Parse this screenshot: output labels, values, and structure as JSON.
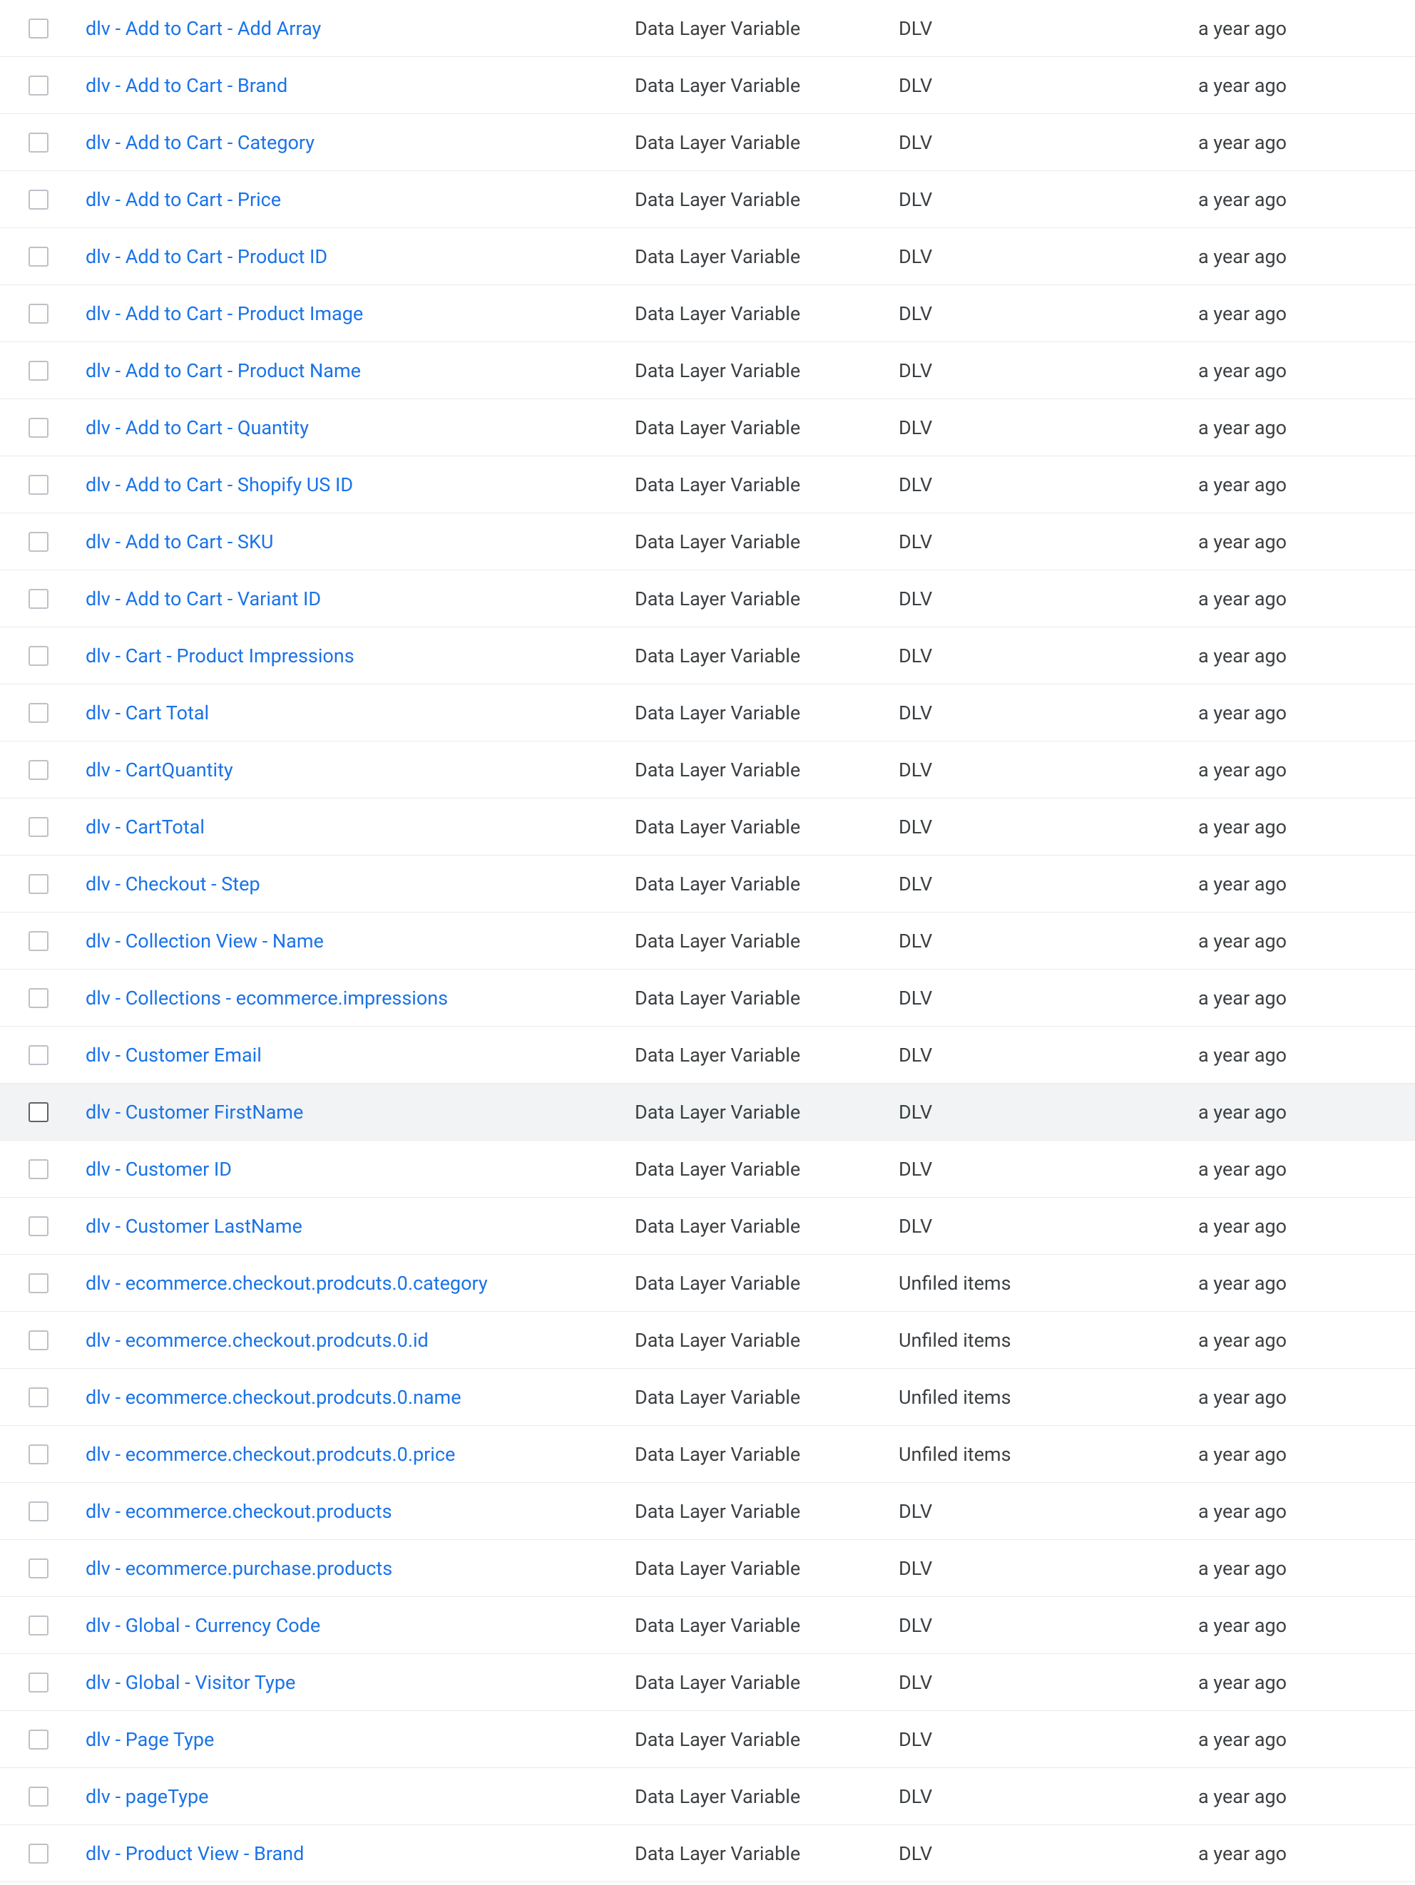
{
  "rows": [
    {
      "name": "dlv - Add to Cart - Add Array",
      "type": "Data Layer Variable",
      "folder": "DLV",
      "modified": "a year ago",
      "hovered": false
    },
    {
      "name": "dlv - Add to Cart - Brand",
      "type": "Data Layer Variable",
      "folder": "DLV",
      "modified": "a year ago",
      "hovered": false
    },
    {
      "name": "dlv - Add to Cart - Category",
      "type": "Data Layer Variable",
      "folder": "DLV",
      "modified": "a year ago",
      "hovered": false
    },
    {
      "name": "dlv - Add to Cart - Price",
      "type": "Data Layer Variable",
      "folder": "DLV",
      "modified": "a year ago",
      "hovered": false
    },
    {
      "name": "dlv - Add to Cart - Product ID",
      "type": "Data Layer Variable",
      "folder": "DLV",
      "modified": "a year ago",
      "hovered": false
    },
    {
      "name": "dlv - Add to Cart - Product Image",
      "type": "Data Layer Variable",
      "folder": "DLV",
      "modified": "a year ago",
      "hovered": false
    },
    {
      "name": "dlv - Add to Cart - Product Name",
      "type": "Data Layer Variable",
      "folder": "DLV",
      "modified": "a year ago",
      "hovered": false
    },
    {
      "name": "dlv - Add to Cart - Quantity",
      "type": "Data Layer Variable",
      "folder": "DLV",
      "modified": "a year ago",
      "hovered": false
    },
    {
      "name": "dlv - Add to Cart - Shopify US ID",
      "type": "Data Layer Variable",
      "folder": "DLV",
      "modified": "a year ago",
      "hovered": false
    },
    {
      "name": "dlv - Add to Cart - SKU",
      "type": "Data Layer Variable",
      "folder": "DLV",
      "modified": "a year ago",
      "hovered": false
    },
    {
      "name": "dlv - Add to Cart - Variant ID",
      "type": "Data Layer Variable",
      "folder": "DLV",
      "modified": "a year ago",
      "hovered": false
    },
    {
      "name": "dlv - Cart - Product Impressions",
      "type": "Data Layer Variable",
      "folder": "DLV",
      "modified": "a year ago",
      "hovered": false
    },
    {
      "name": "dlv - Cart Total",
      "type": "Data Layer Variable",
      "folder": "DLV",
      "modified": "a year ago",
      "hovered": false
    },
    {
      "name": "dlv - CartQuantity",
      "type": "Data Layer Variable",
      "folder": "DLV",
      "modified": "a year ago",
      "hovered": false
    },
    {
      "name": "dlv - CartTotal",
      "type": "Data Layer Variable",
      "folder": "DLV",
      "modified": "a year ago",
      "hovered": false
    },
    {
      "name": "dlv - Checkout - Step",
      "type": "Data Layer Variable",
      "folder": "DLV",
      "modified": "a year ago",
      "hovered": false
    },
    {
      "name": "dlv - Collection View - Name",
      "type": "Data Layer Variable",
      "folder": "DLV",
      "modified": "a year ago",
      "hovered": false
    },
    {
      "name": "dlv - Collections - ecommerce.impressions",
      "type": "Data Layer Variable",
      "folder": "DLV",
      "modified": "a year ago",
      "hovered": false
    },
    {
      "name": "dlv - Customer Email",
      "type": "Data Layer Variable",
      "folder": "DLV",
      "modified": "a year ago",
      "hovered": false
    },
    {
      "name": "dlv - Customer FirstName",
      "type": "Data Layer Variable",
      "folder": "DLV",
      "modified": "a year ago",
      "hovered": true
    },
    {
      "name": "dlv - Customer ID",
      "type": "Data Layer Variable",
      "folder": "DLV",
      "modified": "a year ago",
      "hovered": false
    },
    {
      "name": "dlv - Customer LastName",
      "type": "Data Layer Variable",
      "folder": "DLV",
      "modified": "a year ago",
      "hovered": false
    },
    {
      "name": "dlv - ecommerce.checkout.prodcuts.0.category",
      "type": "Data Layer Variable",
      "folder": "Unfiled items",
      "modified": "a year ago",
      "hovered": false
    },
    {
      "name": "dlv - ecommerce.checkout.prodcuts.0.id",
      "type": "Data Layer Variable",
      "folder": "Unfiled items",
      "modified": "a year ago",
      "hovered": false
    },
    {
      "name": "dlv - ecommerce.checkout.prodcuts.0.name",
      "type": "Data Layer Variable",
      "folder": "Unfiled items",
      "modified": "a year ago",
      "hovered": false
    },
    {
      "name": "dlv - ecommerce.checkout.prodcuts.0.price",
      "type": "Data Layer Variable",
      "folder": "Unfiled items",
      "modified": "a year ago",
      "hovered": false
    },
    {
      "name": "dlv - ecommerce.checkout.products",
      "type": "Data Layer Variable",
      "folder": "DLV",
      "modified": "a year ago",
      "hovered": false
    },
    {
      "name": "dlv - ecommerce.purchase.products",
      "type": "Data Layer Variable",
      "folder": "DLV",
      "modified": "a year ago",
      "hovered": false
    },
    {
      "name": "dlv - Global - Currency Code",
      "type": "Data Layer Variable",
      "folder": "DLV",
      "modified": "a year ago",
      "hovered": false
    },
    {
      "name": "dlv - Global - Visitor Type",
      "type": "Data Layer Variable",
      "folder": "DLV",
      "modified": "a year ago",
      "hovered": false
    },
    {
      "name": "dlv - Page Type",
      "type": "Data Layer Variable",
      "folder": "DLV",
      "modified": "a year ago",
      "hovered": false
    },
    {
      "name": "dlv - pageType",
      "type": "Data Layer Variable",
      "folder": "DLV",
      "modified": "a year ago",
      "hovered": false
    },
    {
      "name": "dlv - Product View - Brand",
      "type": "Data Layer Variable",
      "folder": "DLV",
      "modified": "a year ago",
      "hovered": false
    }
  ]
}
